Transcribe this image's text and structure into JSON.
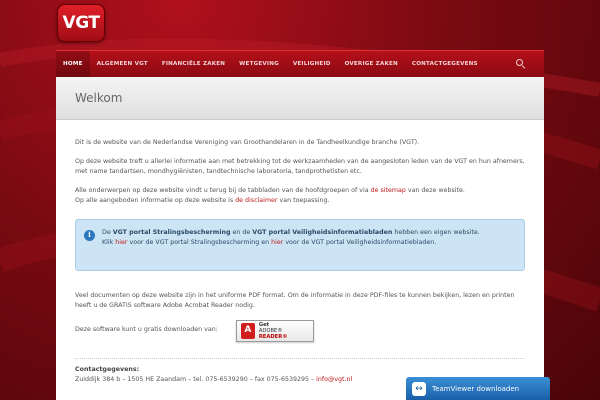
{
  "logo": {
    "text": "VGT"
  },
  "nav": {
    "items": [
      "HOME",
      "ALGEMEEN VGT",
      "FINANCIËLE ZAKEN",
      "WETGEVING",
      "VEILIGHEID",
      "OVERIGE ZAKEN",
      "CONTACTGEGEVENS"
    ],
    "search_icon": "search-icon"
  },
  "page": {
    "title": "Welkom"
  },
  "content": {
    "p1": "Dit is de website van de Nederlandse Vereniging van Groothandelaren in de Tandheelkundige branche (VGT).",
    "p2": "Op deze website treft u allerlei informatie aan met betrekking tot de werkzaamheden van de aangesloten leden van de VGT en hun afnemers, met name tandartsen, mondhygiënisten, tandtechnische laboratoria, tandprothetisten etc.",
    "p3_pre": "Alle onderwerpen op deze website vindt u terug bij de tabbladen van de hoofdgroepen of via ",
    "p3_link": "de sitemap",
    "p3_post": " van deze website.",
    "p4_pre": "Op alle aangeboden informatie op deze website is ",
    "p4_link": "de disclaimer",
    "p4_post": " van toepassing.",
    "info": {
      "t1": "De ",
      "b1": "VGT portal Stralingsbescherming",
      "t2": " en de ",
      "b2": "VGT portal Veiligheidsinformatiebladen",
      "t3": " hebben een eigen website.",
      "t4": "Klik ",
      "l1": "hier",
      "t5": " voor de VGT portal Stralingsbescherming en ",
      "l2": "hier",
      "t6": " voor de VGT portal Veiligheidsinformatiebladen."
    },
    "p5": "Veel documenten op deze website zijn in het uniforme PDF format. Om de informatie in deze PDF-files te kunnen bekijken, lezen en printen heeft u de GRATIS software Adobe Acrobat Reader nodig.",
    "download_label": "Deze software kunt u gratis downloaden van:",
    "adobe": {
      "get": "Get",
      "brand": "ADOBE®",
      "reader": "READER®"
    },
    "contact": {
      "title": "Contactgegevens:",
      "line_pre": "Zuiddijk 384 b – 1505 HE Zaandam – tel. 075-6539290 – fax 075-6539295 – ",
      "email": "info@vgt.nl"
    }
  },
  "teamviewer": {
    "label": "TeamViewer downloaden"
  }
}
